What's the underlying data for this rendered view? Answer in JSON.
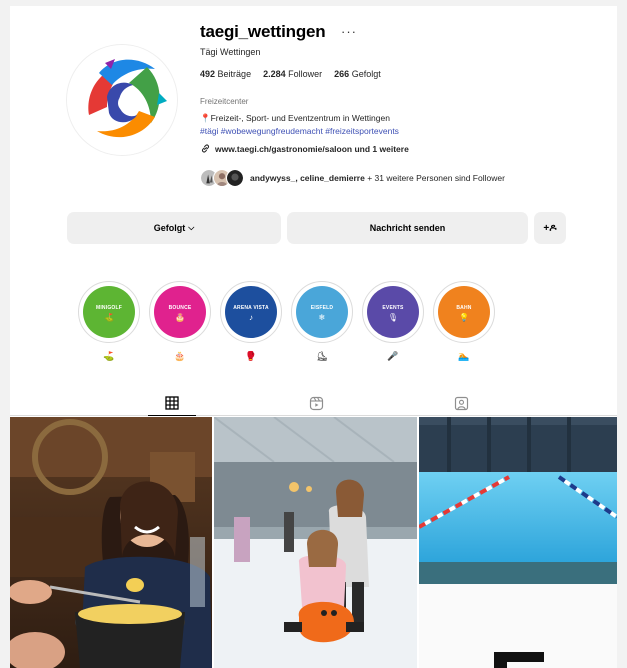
{
  "profile": {
    "username": "taegi_wettingen",
    "more": "···",
    "full_name": "Tägi Wettingen",
    "stats": {
      "posts_count": "492",
      "posts_label": "Beiträge",
      "followers_count": "2.284",
      "followers_label": "Follower",
      "following_count": "266",
      "following_label": "Gefolgt"
    },
    "category": "Freizeitcenter",
    "bio_line1": "📍Freizeit-, Sport- und Eventzentrum in Wettingen",
    "bio_line2": "#tägi #wobewegungfreudemacht #freizeitsportevents",
    "link": "www.taegi.ch/gastronomie/saloon und 1 weitere",
    "followed_by_names": "andywyss_, celine_demierre",
    "followed_by_rest": " + 31 weitere Personen sind Follower"
  },
  "actions": {
    "follow_label": "Gefolgt",
    "follow_chevron": "⌵",
    "message_label": "Nachricht senden",
    "add_user_label": "+ዶ"
  },
  "highlights": [
    {
      "title": "MINIGOLF",
      "glyph": "⛳",
      "label": "⛳",
      "color": "#5db533"
    },
    {
      "title": "BOUNCE",
      "glyph": "🎂",
      "label": "🎂",
      "color": "#e0228e"
    },
    {
      "title": "ARENA VISTA",
      "glyph": "♪",
      "label": "🥊",
      "color": "#1d4f9e"
    },
    {
      "title": "EISFELD",
      "glyph": "❄",
      "label": "⛸",
      "color": "#4aa6d9"
    },
    {
      "title": "EVENTS",
      "glyph": "🎙",
      "label": "🎤",
      "color": "#5a4aa8"
    },
    {
      "title": "BAHN",
      "glyph": "💡",
      "label": "🏊",
      "color": "#f0821e"
    }
  ],
  "tabs": [
    "posts",
    "reels",
    "tagged"
  ],
  "colors": {
    "accent_link": "#3f51b5",
    "button_bg": "#efefef"
  }
}
